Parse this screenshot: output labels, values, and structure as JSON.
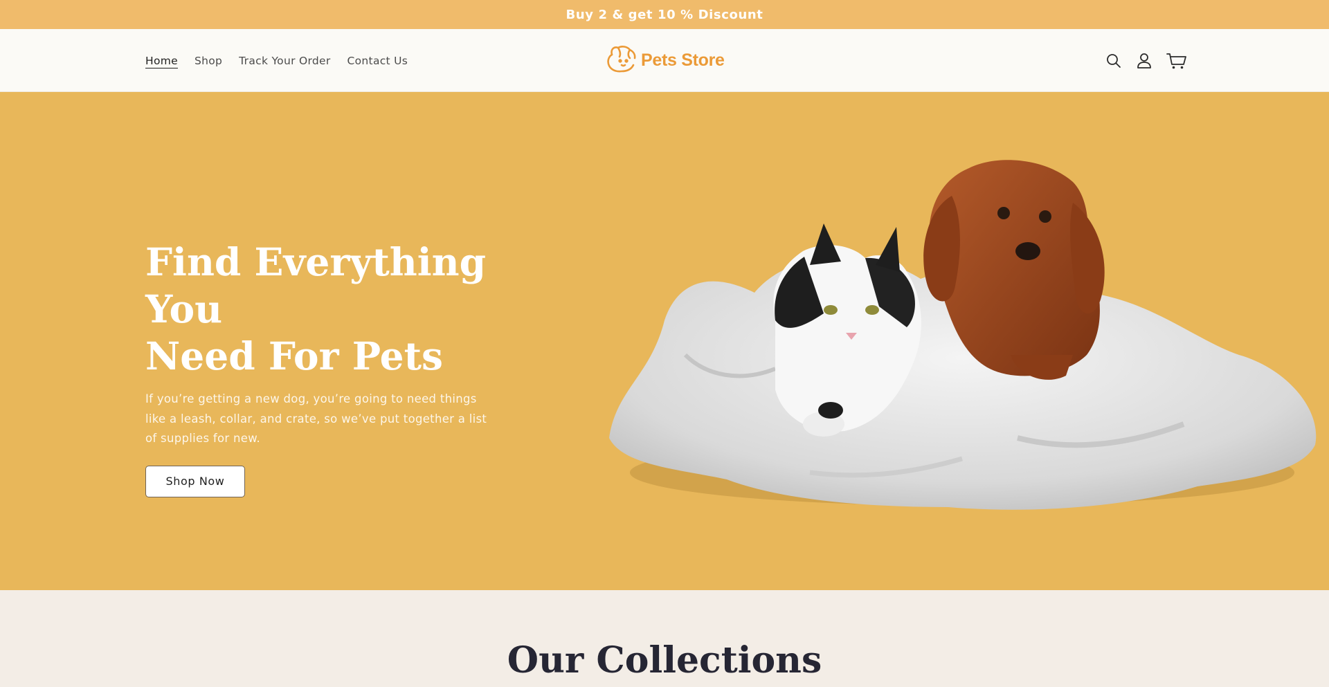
{
  "announcement": {
    "text": "Buy 2 & get 10 % Discount"
  },
  "header": {
    "nav": [
      {
        "label": "Home",
        "active": true
      },
      {
        "label": "Shop",
        "active": false
      },
      {
        "label": "Track Your Order",
        "active": false
      },
      {
        "label": "Contact Us",
        "active": false
      }
    ],
    "logo_text": "Pets Store",
    "icons": [
      "search-icon",
      "account-icon",
      "cart-icon"
    ]
  },
  "hero": {
    "title_line1": "Find Everything You",
    "title_line2": "Need For Pets",
    "subtitle": "If you’re getting a new dog, you’re going to need things like a leash, collar, and crate, so we’ve put together a list of supplies for new.",
    "cta_label": "Shop Now",
    "background_color": "#e8b75a"
  },
  "collections": {
    "title": "Our Collections"
  },
  "colors": {
    "announcement_bg": "#f0bb6b",
    "brand_orange": "#eb9a37",
    "header_bg": "#fbfaf6",
    "page_bg": "#f3ede6",
    "heading_dark": "#262634"
  }
}
